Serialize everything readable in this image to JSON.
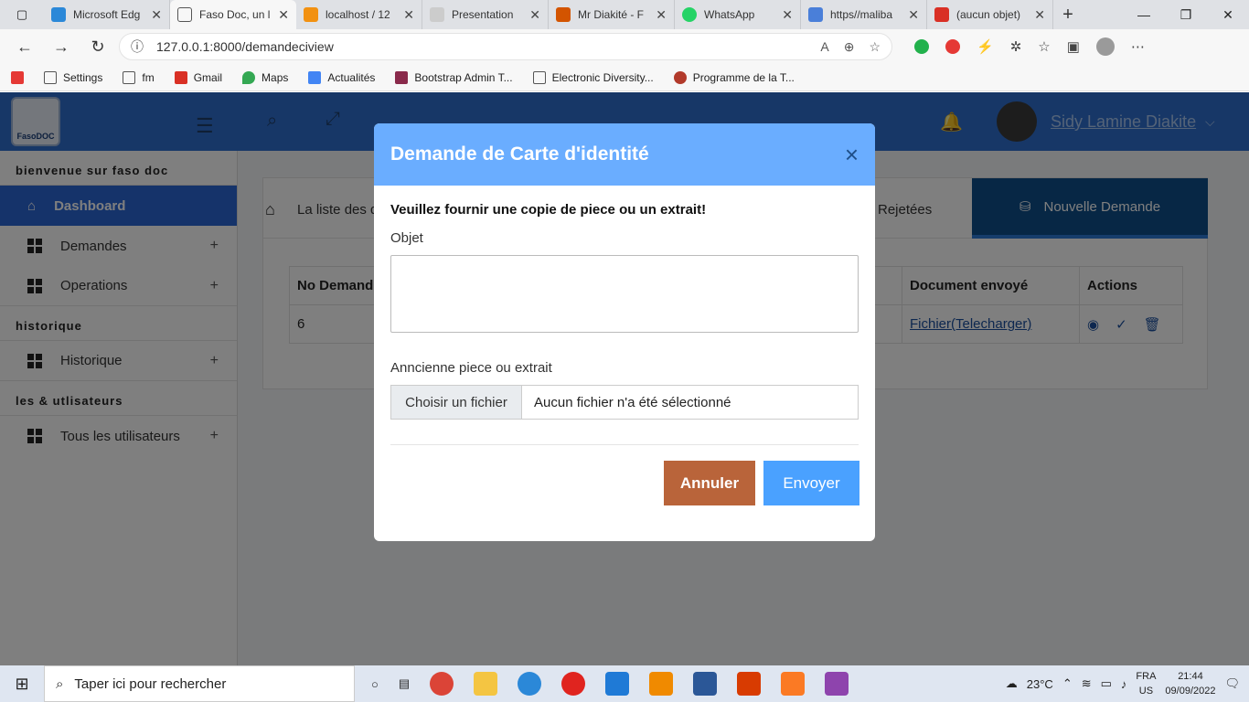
{
  "browser": {
    "tabs": [
      {
        "title": "Microsoft Edg",
        "color": "#2b88d8"
      },
      {
        "title": "Faso Doc, un l",
        "color": "#ffffff",
        "active": true
      },
      {
        "title": "localhost / 12",
        "color": "#f29111"
      },
      {
        "title": "Presentation",
        "color": "#cccccc"
      },
      {
        "title": "Mr Diakité - F",
        "color": "#d35400"
      },
      {
        "title": "WhatsApp",
        "color": "#25d366"
      },
      {
        "title": "https//maliba",
        "color": "#4a7fd9"
      },
      {
        "title": "(aucun objet)",
        "color": "#d93025"
      }
    ],
    "url": "127.0.0.1:8000/demandeciview",
    "bookmarks": [
      "Settings",
      "fm",
      "Gmail",
      "Maps",
      "Actualités",
      "Bootstrap Admin T...",
      "Electronic Diversity...",
      "Programme de la T..."
    ]
  },
  "app": {
    "user_name": "Sidy Lamine Diakite",
    "logo_text": "FasoDOC",
    "sidebar": {
      "section1": "bienvenue sur faso doc",
      "item_dashboard": "Dashboard",
      "item_demandes": "Demandes",
      "item_operations": "Operations",
      "section2": "historique",
      "item_historique": "Historique",
      "section3": "les & utlisateurs",
      "item_users": "Tous les utilisateurs",
      "plus": "+"
    },
    "content": {
      "tab_list": "La liste des d",
      "tab_rejected": "Rejetées",
      "tab_new": "Nouvelle Demande",
      "table": {
        "headers": [
          "No Demand",
          "Document envoyé",
          "Actions"
        ],
        "row": {
          "no": "6",
          "doc": "Fichier(Telecharger)"
        }
      }
    }
  },
  "modal": {
    "title": "Demande de Carte d'identité",
    "close": "×",
    "subtitle": "Veuillez fournir une copie de piece ou un extrait!",
    "objet_label": "Objet",
    "piece_label": "Anncienne piece ou extrait",
    "file_button": "Choisir un fichier",
    "file_status": "Aucun fichier n'a été sélectionné",
    "cancel": "Annuler",
    "send": "Envoyer"
  },
  "taskbar": {
    "search_placeholder": "Taper ici pour rechercher",
    "weather": "23°C",
    "lang": "FRA",
    "region": "US",
    "time": "21:44",
    "date": "09/09/2022"
  }
}
